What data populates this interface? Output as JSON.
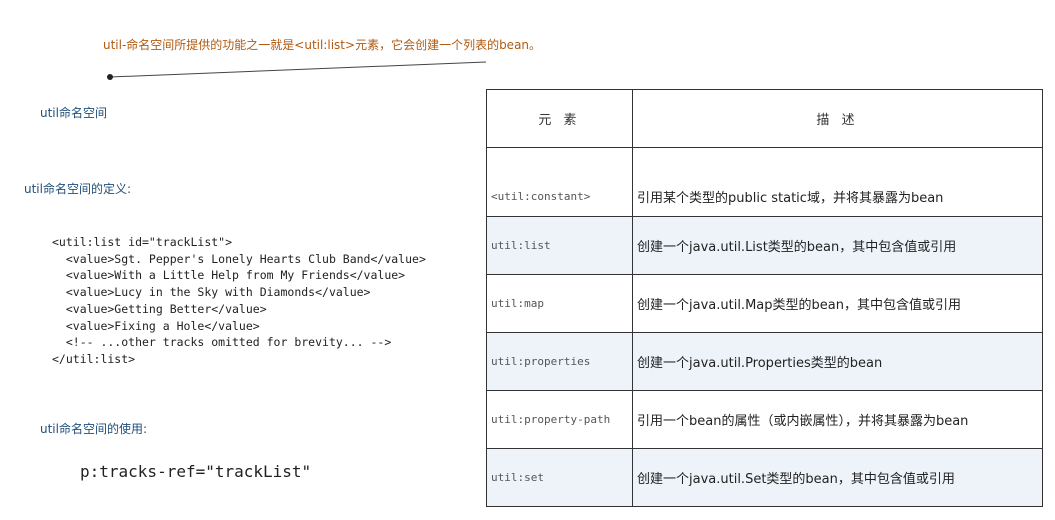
{
  "intro": "util-命名空间所提供的功能之一就是<util:list>元素，它会创建一个列表的bean。",
  "headings": {
    "namespace": "util命名空间",
    "definition": "util命名空间的定义:",
    "usage": "util命名空间的使用:"
  },
  "code": "<util:list id=\"trackList\">\n  <value>Sgt. Pepper's Lonely Hearts Club Band</value>\n  <value>With a Little Help from My Friends</value>\n  <value>Lucy in the Sky with Diamonds</value>\n  <value>Getting Better</value>\n  <value>Fixing a Hole</value>\n  <!-- ...other tracks omitted for brevity... -->\n</util:list>",
  "usage_line": "p:tracks-ref=\"trackList\"",
  "table": {
    "header_element": "元 素",
    "header_description": "描 述",
    "rows": [
      {
        "element": "<util:constant>",
        "description": "引用某个类型的public static域，并将其暴露为bean"
      },
      {
        "element": "util:list",
        "description": "创建一个java.util.List类型的bean，其中包含值或引用"
      },
      {
        "element": "util:map",
        "description": "创建一个java.util.Map类型的bean，其中包含值或引用"
      },
      {
        "element": "util:properties",
        "description": "创建一个java.util.Properties类型的bean"
      },
      {
        "element": "util:property-path",
        "description": "引用一个bean的属性（或内嵌属性），并将其暴露为bean"
      },
      {
        "element": "util:set",
        "description": "创建一个java.util.Set类型的bean，其中包含值或引用"
      }
    ]
  }
}
